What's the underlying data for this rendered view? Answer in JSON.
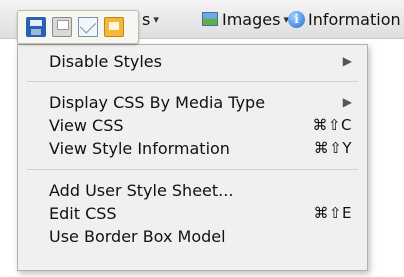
{
  "toolbar": {
    "styles_label": "s",
    "images_label": "Images",
    "info_label": "Information",
    "info_glyph": "i",
    "dropdown_arrow": "▾"
  },
  "palette": {
    "icons": [
      "save-icon",
      "print-icon",
      "mail-icon",
      "note-icon"
    ]
  },
  "menu": {
    "items": [
      {
        "label": "Disable Styles",
        "submenu": true,
        "shortcut": ""
      },
      {
        "label": "Display CSS By Media Type",
        "submenu": true,
        "shortcut": ""
      },
      {
        "label": "View CSS",
        "submenu": false,
        "shortcut": "⌘⇧C"
      },
      {
        "label": "View Style Information",
        "submenu": false,
        "shortcut": "⌘⇧Y"
      },
      {
        "label": "Add User Style Sheet...",
        "submenu": false,
        "shortcut": ""
      },
      {
        "label": "Edit CSS",
        "submenu": false,
        "shortcut": "⌘⇧E"
      },
      {
        "label": "Use Border Box Model",
        "submenu": false,
        "shortcut": ""
      }
    ],
    "submenu_arrow": "▶"
  },
  "colors": {
    "menu_bg": "#f0f0f0",
    "separator": "#cfcfcf",
    "info_blue": "#1e6fd0"
  }
}
